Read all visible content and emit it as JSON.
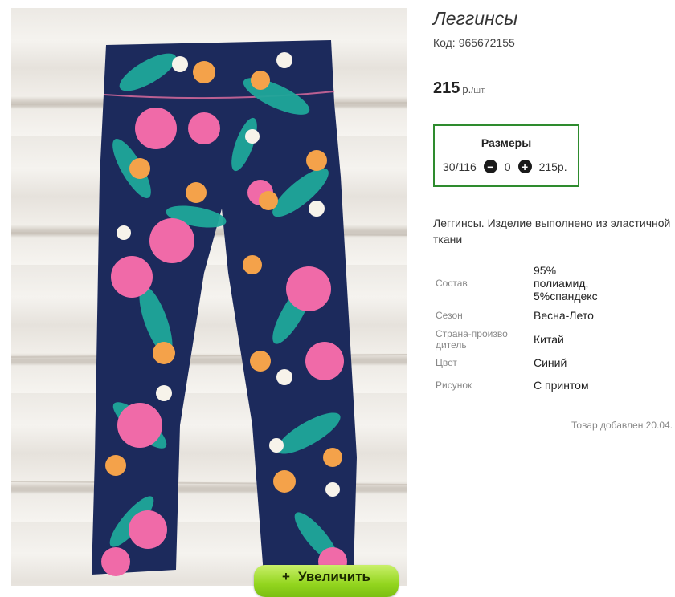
{
  "product": {
    "title": "Леггинсы",
    "code_label": "Код:",
    "code_value": "965672155",
    "price_value": "215",
    "price_unit": "р.",
    "price_per": "/шт.",
    "zoom_button_label": "Увеличить",
    "zoom_button_icon": "plus-icon"
  },
  "sizes": {
    "title": "Размеры",
    "size_label": "30/116",
    "quantity": "0",
    "price": "215р.",
    "minus_icon": "minus-icon",
    "plus_icon": "plus-icon"
  },
  "description": "Леггинсы. Изделие выполнено из эластичной ткани",
  "properties": [
    {
      "name": "Состав",
      "value": "95% полиамид, 5%спандекс"
    },
    {
      "name": "Сезон",
      "value": "Весна-Лето"
    },
    {
      "name": "Страна-производитель",
      "value": "Китай"
    },
    {
      "name": "Цвет",
      "value": "Синий"
    },
    {
      "name": "Рисунок",
      "value": "С принтом"
    }
  ],
  "added_text": "Товар добавлен 20.04.",
  "colors": {
    "sizes_border": "#2e8b2e",
    "button_green": "#93d51e",
    "legging_navy": "#1c2a5c",
    "leaf_teal": "#1fa79a",
    "flower_pink": "#f06aa8",
    "flower_orange": "#f4a24a"
  }
}
